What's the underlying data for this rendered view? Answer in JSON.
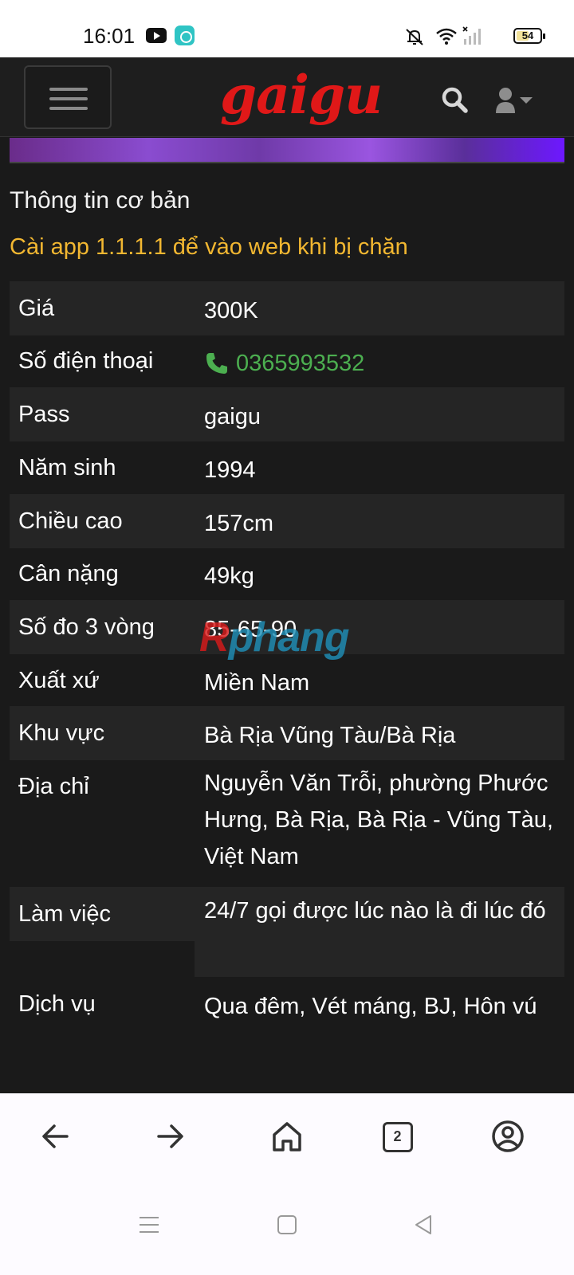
{
  "status_bar": {
    "time": "16:01",
    "battery": "54",
    "battery_level": 0.54,
    "icons": [
      "youtube-icon",
      "app-icon",
      "bell-off-icon",
      "wifi-icon",
      "signal-icon",
      "battery-icon"
    ]
  },
  "header": {
    "logo": "gaigu",
    "logo_color": "#e01818",
    "icons": [
      "menu-icon",
      "search-icon",
      "user-icon",
      "caret-down-icon"
    ]
  },
  "section_title": "Thông tin cơ bản",
  "notice": "Cài app 1.1.1.1 để vào web khi bị chặn",
  "notice_color": "#f2b731",
  "table": [
    {
      "label": "Giá",
      "value": "300K"
    },
    {
      "label": "Số điện thoại",
      "value": "0365993532"
    },
    {
      "label": "Pass",
      "value": "gaigu"
    },
    {
      "label": "Năm sinh",
      "value": "1994"
    },
    {
      "label": "Chiều cao",
      "value": "157cm"
    },
    {
      "label": "Cân nặng",
      "value": "49kg"
    },
    {
      "label": "Số đo 3 vòng",
      "value": "85-65-90"
    },
    {
      "label": "Xuất xứ",
      "value": "Miền Nam"
    },
    {
      "label": "Khu vực",
      "value": "Bà Rịa Vũng Tàu/Bà Rịa"
    },
    {
      "label": "Địa chỉ",
      "value": "Nguyễn Văn Trỗi, phường Phước Hưng, Bà Rịa, Bà Rịa - Vũng Tàu, Việt Nam"
    },
    {
      "label": "Làm việc",
      "value": "24/7 gọi được lúc nào là đi lúc đó"
    },
    {
      "label": "Dịch vụ",
      "value": "Qua đêm, Vét máng, BJ, Hôn vú"
    }
  ],
  "phone_color": "#4caf50",
  "watermark": {
    "part1": "R",
    "part2": "phang"
  },
  "browser_bar": {
    "tab_count": "2",
    "icons": [
      "back-arrow-icon",
      "forward-arrow-icon",
      "home-icon",
      "tabs-icon",
      "account-icon"
    ]
  },
  "system_nav": {
    "icons": [
      "recents-icon",
      "home-square-icon",
      "back-triangle-icon"
    ]
  }
}
